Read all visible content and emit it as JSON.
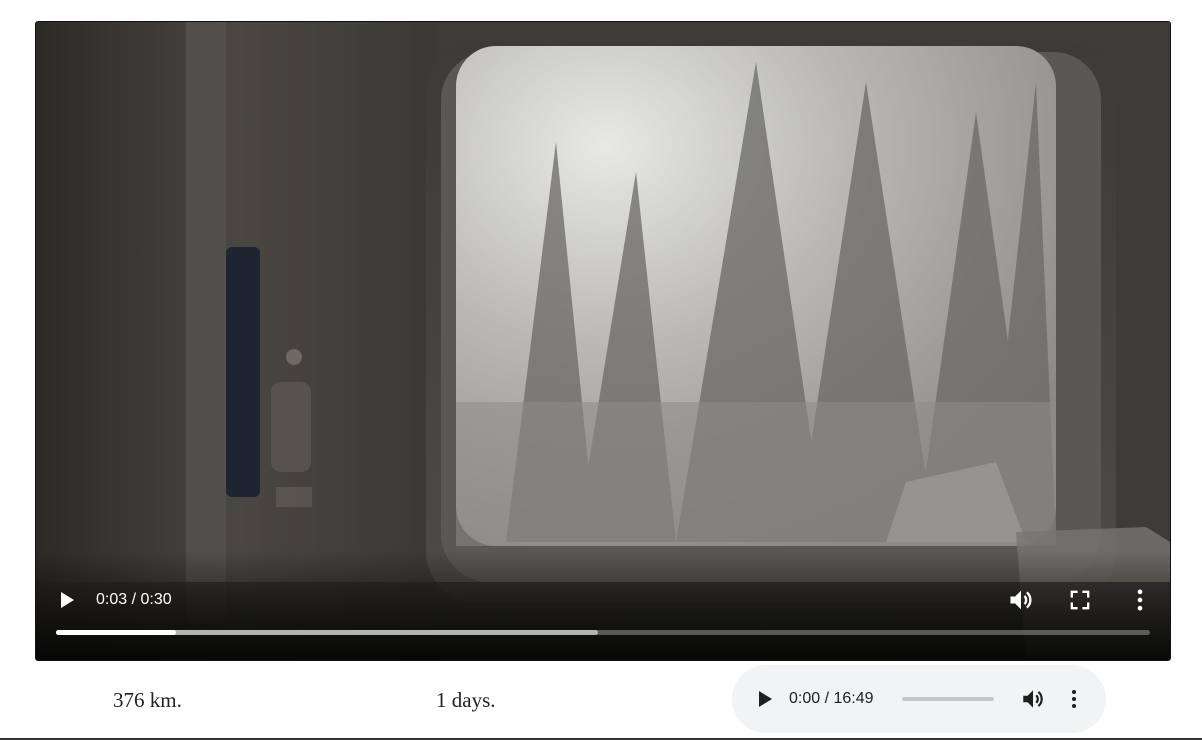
{
  "video_player": {
    "current_time": "0:03",
    "duration": "0:30",
    "time_display": "0:03 / 0:30",
    "played_fraction": 0.11,
    "buffered_fraction": 0.495,
    "controls": {
      "play_icon": "play-icon",
      "mute_icon": "volume-icon",
      "fullscreen_icon": "fullscreen-icon",
      "more_icon": "more-vertical-icon"
    }
  },
  "stats": {
    "distance": "376 km.",
    "days": "1 days."
  },
  "audio_player": {
    "time_display": "0:00 / 16:49",
    "current_time": "0:00",
    "duration": "16:49",
    "played_fraction": 0,
    "controls": {
      "play_icon": "play-icon",
      "mute_icon": "volume-icon",
      "more_icon": "more-vertical-icon"
    }
  },
  "colors": {
    "audio_background": "#f1f3f4",
    "progress_played": "#ffffff",
    "progress_buffered": "#bfbfbf",
    "audio_track": "#c4c6c7"
  }
}
